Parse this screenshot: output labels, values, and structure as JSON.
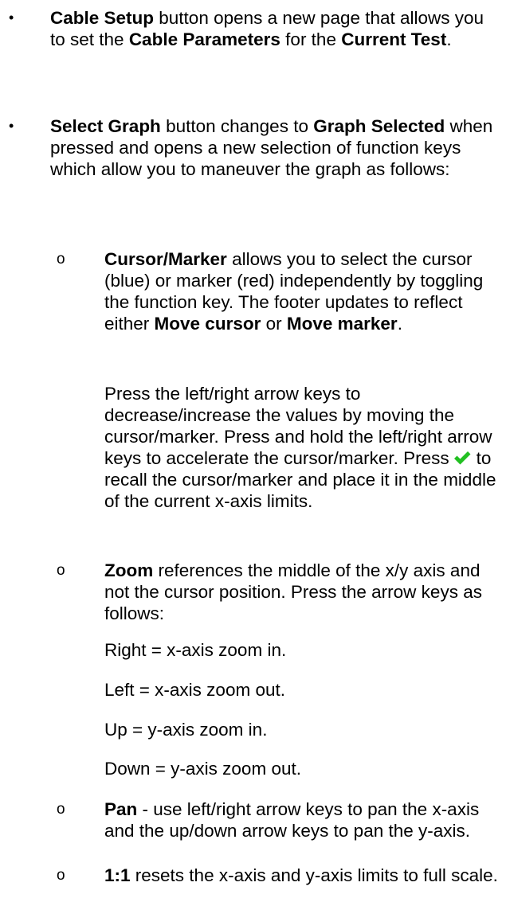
{
  "bullets": {
    "cable_setup": {
      "title": "Cable Setup",
      "t1": " button opens a new page that allows you to set the ",
      "b1": "Cable Parameters",
      "t2": " for the ",
      "b2": "Current Test",
      "t3": "."
    },
    "select_graph": {
      "title": "Select Graph",
      "t1": " button changes to ",
      "b1": "Graph Selected",
      "t2": " when pressed and opens a new selection of function keys which allow you to maneuver the graph as follows:"
    }
  },
  "sub": {
    "cursor_marker": {
      "title": "Cursor/Marker",
      "t1": " allows you to select the cursor (blue) or marker (red) independently by toggling the function key. The footer updates to reflect either ",
      "b1": "Move cursor",
      "t2": " or ",
      "b2": "Move marker",
      "t3": ".",
      "p2_a": "Press the left/right arrow keys to decrease/increase the values by moving the cursor/marker. Press and hold the left/right arrow keys to accelerate the cursor/marker. Press",
      "p2_b": "to recall the cursor/marker and place it in the middle of the current x-axis limits."
    },
    "zoom": {
      "title": "Zoom",
      "t1": " references the middle of the x/y axis and not the cursor position. Press the arrow keys as follows:",
      "lines": [
        "Right = x-axis zoom in.",
        "Left = x-axis zoom out.",
        "Up = y-axis zoom in.",
        "Down = y-axis zoom out."
      ]
    },
    "pan": {
      "title": "Pan",
      "t1": " - use left/right arrow keys to pan the x-axis and the up/down arrow keys to pan the y-axis."
    },
    "one_to_one": {
      "title": "1:1",
      "t1": " resets the x-axis and y-axis limits to full scale."
    }
  },
  "markers": {
    "bullet": "•",
    "sub": "o"
  },
  "icons": {
    "check": "check-icon"
  },
  "colors": {
    "check_icon": "#22c022"
  }
}
